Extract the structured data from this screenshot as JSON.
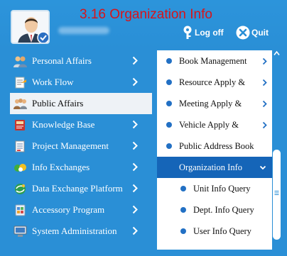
{
  "header": {
    "title": "3.16 Organization Info",
    "logoff_label": "Log off",
    "quit_label": "Quit"
  },
  "menu": {
    "items": [
      {
        "label": "Personal Affairs",
        "icon": "personal-affairs-icon"
      },
      {
        "label": "Work Flow",
        "icon": "work-flow-icon"
      },
      {
        "label": "Public Affairs",
        "icon": "public-affairs-icon",
        "active": true
      },
      {
        "label": "Knowledge Base",
        "icon": "knowledge-base-icon"
      },
      {
        "label": "Project Management",
        "icon": "project-management-icon"
      },
      {
        "label": "Info Exchanges",
        "icon": "info-exchanges-icon"
      },
      {
        "label": "Data Exchange Platform",
        "icon": "data-exchange-icon"
      },
      {
        "label": "Accessory Program",
        "icon": "accessory-program-icon"
      },
      {
        "label": "System Administration",
        "icon": "system-admin-icon"
      }
    ]
  },
  "submenu": {
    "items": [
      {
        "label": "Book Management",
        "has_children": true
      },
      {
        "label": "Resource Apply &",
        "has_children": true
      },
      {
        "label": "Meeting Apply &",
        "has_children": true
      },
      {
        "label": "Vehicle Apply &",
        "has_children": true
      },
      {
        "label": "Public Address Book",
        "has_children": false
      },
      {
        "label": "Organization Info",
        "expanded": true
      },
      {
        "label": "Unit Info Query",
        "child": true
      },
      {
        "label": "Dept. Info Query",
        "child": true
      },
      {
        "label": "User Info Query",
        "child": true
      }
    ]
  },
  "colors": {
    "background": "#2a8fd6",
    "title": "#d7141a",
    "active_menu_bg": "#eef2f6",
    "expanded_bg": "#1565b8",
    "bullet": "#2270c4"
  }
}
